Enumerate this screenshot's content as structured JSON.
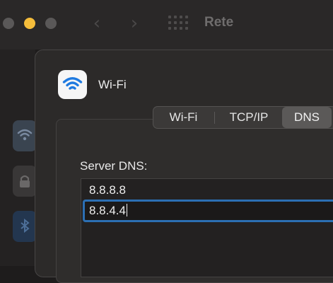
{
  "window": {
    "title": "Rete"
  },
  "titlebar": {
    "back_icon": "chevron-left-icon",
    "forward_icon": "chevron-right-icon",
    "grid_icon": "grid-icon",
    "back_glyph": "‹",
    "forward_glyph": "›"
  },
  "sheet": {
    "service_name": "Wi-Fi",
    "service_icon": "wifi-icon",
    "tabs": [
      {
        "label": "Wi-Fi",
        "selected": false
      },
      {
        "label": "TCP/IP",
        "selected": false
      },
      {
        "label": "DNS",
        "selected": true
      }
    ],
    "dns": {
      "label": "Server DNS:",
      "servers": [
        "8.8.8.8",
        "8.8.4.4"
      ],
      "editing_index": 1
    }
  },
  "colors": {
    "accent": "#2c6fb3",
    "traffic_yellow": "#f5bd3b",
    "wifi_blue": "#1f7ae0"
  }
}
